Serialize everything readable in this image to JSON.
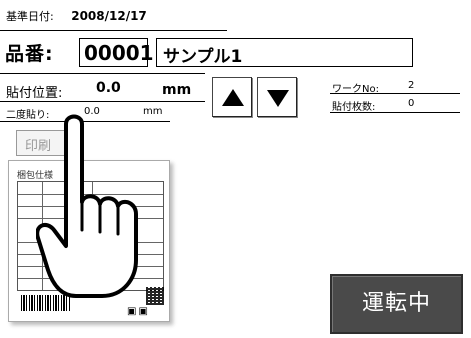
{
  "header": {
    "base_date_label": "基準日付:",
    "base_date_value": "2008/12/17"
  },
  "part": {
    "label": "品番:",
    "number": "00001",
    "name": "サンプル1"
  },
  "position": {
    "label": "貼付位置:",
    "value": "0.0",
    "unit": "mm"
  },
  "secondary": {
    "label": "二度貼り:",
    "value": "0.0",
    "unit": "mm"
  },
  "info": {
    "work_no_label": "ワークNo:",
    "work_no_value": "2",
    "count_label": "貼付枚数:",
    "count_value": "0"
  },
  "print_button": {
    "label": "印刷"
  },
  "label_preview": {
    "title": "梱包仕様"
  },
  "status": {
    "label": "運転中"
  },
  "icons": {
    "up": "triangle-up-icon",
    "down": "triangle-down-icon",
    "hand": "pointing-hand-icon"
  }
}
